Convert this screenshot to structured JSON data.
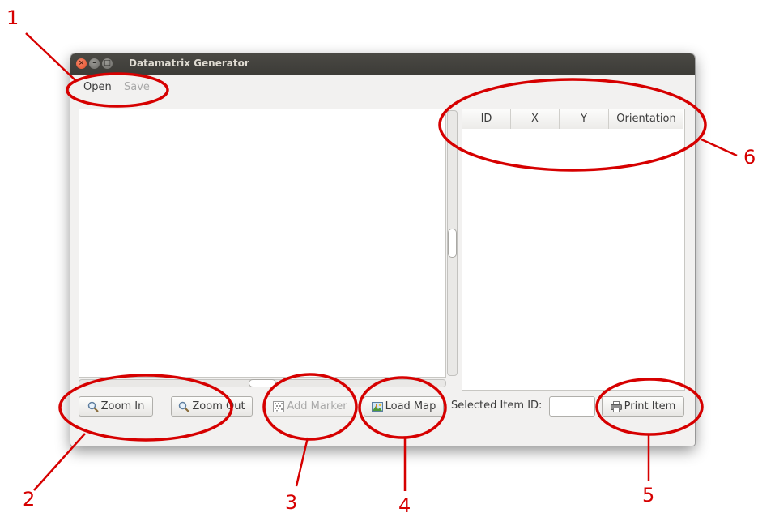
{
  "window": {
    "title": "Datamatrix Generator",
    "close_glyph": "×",
    "min_glyph": "–",
    "max_glyph": "□"
  },
  "menu": {
    "open_label": "Open",
    "save_label": "Save"
  },
  "table": {
    "columns": [
      "ID",
      "X",
      "Y",
      "Orientation"
    ],
    "rows": []
  },
  "toolbar": {
    "zoom_in_label": "Zoom In",
    "zoom_out_label": "Zoom Out",
    "add_marker_label": "Add Marker",
    "load_map_label": "Load Map",
    "selected_item_label": "Selected Item ID:",
    "selected_item_value": "",
    "print_item_label": "Print Item"
  },
  "icons": {
    "zoom_in": "magnifier-icon",
    "zoom_out": "magnifier-icon",
    "add_marker": "datamatrix-icon",
    "load_map": "map-image-icon",
    "print_item": "printer-icon"
  },
  "annotations": {
    "labels": [
      "1",
      "2",
      "3",
      "4",
      "5",
      "6"
    ],
    "color": "#d60000"
  }
}
